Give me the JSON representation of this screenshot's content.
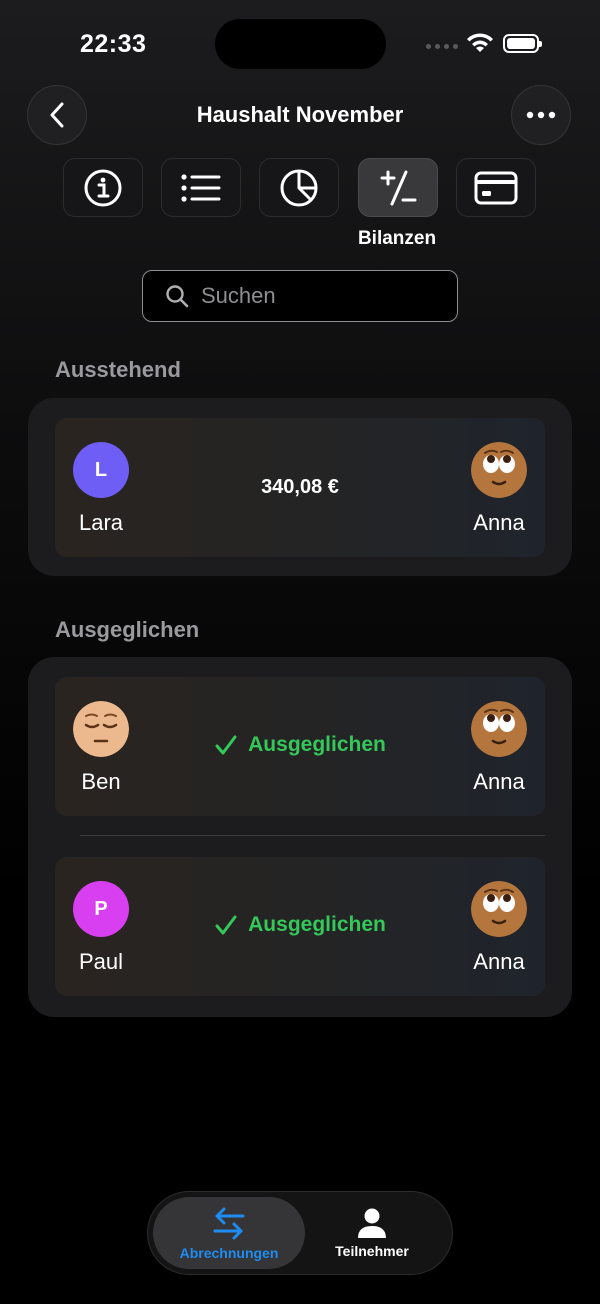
{
  "status": {
    "time": "22:33"
  },
  "header": {
    "title": "Haushalt November"
  },
  "tabs": {
    "active_label": "Bilanzen"
  },
  "search": {
    "placeholder": "Suchen"
  },
  "pending": {
    "title": "Ausstehend",
    "items": [
      {
        "from": "Lara",
        "from_initial": "L",
        "amount": "340,08 €",
        "to": "Anna"
      }
    ]
  },
  "settled": {
    "title": "Ausgeglichen",
    "status_label": "Ausgeglichen",
    "items": [
      {
        "from": "Ben",
        "to": "Anna"
      },
      {
        "from": "Paul",
        "from_initial": "P",
        "to": "Anna"
      }
    ]
  },
  "bottom_nav": {
    "items": [
      {
        "label": "Abrechnungen"
      },
      {
        "label": "Teilnehmer"
      }
    ]
  },
  "colors": {
    "accent": "#1e8cf0",
    "settled": "#34c759",
    "lara_avatar": "#6e5ef5",
    "paul_avatar": "#d83ff0",
    "emoji_skin_dark": "#b5763e",
    "emoji_skin_light": "#ecb98f"
  }
}
